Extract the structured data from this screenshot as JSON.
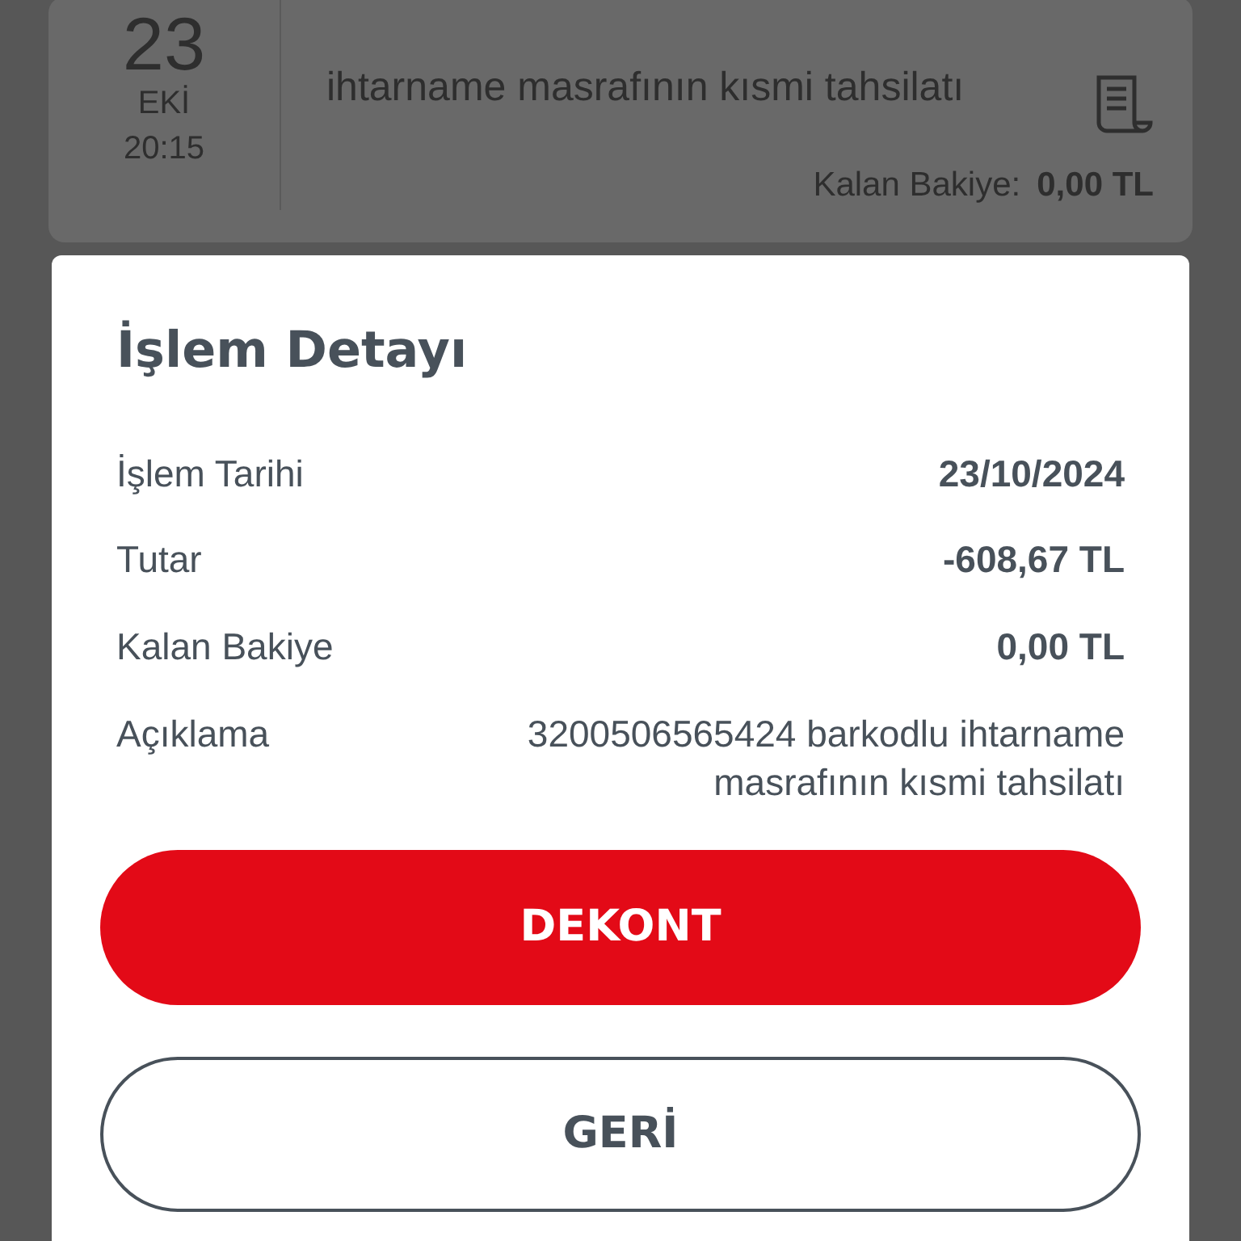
{
  "background_item": {
    "day": "23",
    "month": "EKİ",
    "time": "20:15",
    "description": "ihtarname masrafının kısmi tahsilatı",
    "balance_label": "Kalan Bakiye:",
    "balance_value": "0,00 TL"
  },
  "dialog": {
    "title": "İşlem Detayı",
    "rows": [
      {
        "label": "İşlem Tarihi",
        "value": "23/10/2024",
        "kind": "bold"
      },
      {
        "label": "Tutar",
        "value": "-608,67 TL",
        "kind": "bold"
      },
      {
        "label": "Kalan Bakiye",
        "value": "0,00 TL",
        "kind": "bold"
      },
      {
        "label": "Açıklama",
        "value": "3200506565424 barkodlu ihtarname masrafının kısmi tahsilatı",
        "kind": "plain"
      }
    ],
    "buttons": [
      {
        "label": "DEKONT",
        "kind": "primary"
      },
      {
        "label": "GERİ",
        "kind": "outline"
      }
    ]
  }
}
